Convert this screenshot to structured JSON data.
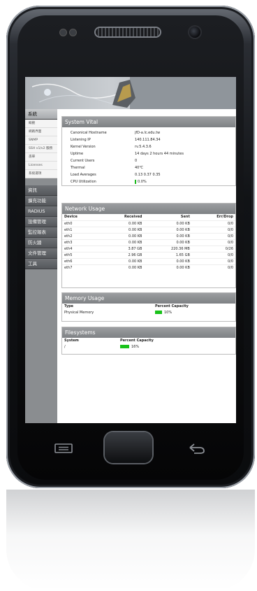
{
  "sidebar": {
    "groups": [
      {
        "label": "系統",
        "items": [
          "概觀",
          "網路界面",
          "SNMP",
          "SSH v1/v2 服務",
          "憑單",
          "Licenses",
          "系統選項"
        ]
      },
      {
        "label": "資訊"
      },
      {
        "label": "擴充功能"
      },
      {
        "label": "RADIUS"
      },
      {
        "label": "設備管理"
      },
      {
        "label": "監控報表"
      },
      {
        "label": "防火牆"
      },
      {
        "label": "文件管理"
      },
      {
        "label": "工具"
      }
    ]
  },
  "system_vital": {
    "title": "System Vital",
    "rows": [
      {
        "key": "Canonical Hostname",
        "value": "jfD-a.lc.edu.tw"
      },
      {
        "key": "Listening IP",
        "value": "140.111.84.34"
      },
      {
        "key": "Kernel Version",
        "value": "rv.5.4.3.6"
      },
      {
        "key": "Uptime",
        "value": "14 days 2 hours 44 minutes"
      },
      {
        "key": "Current Users",
        "value": "0"
      },
      {
        "key": "Thermal",
        "value": "40℃"
      },
      {
        "key": "Load Averages",
        "value": "0.13 0.37 0.35"
      },
      {
        "key": "CPU Utilization",
        "value": "0.0%"
      }
    ]
  },
  "network_usage": {
    "title": "Network Usage",
    "columns": [
      "Device",
      "Received",
      "Sent",
      "Err/Drop"
    ],
    "rows": [
      [
        "eth0",
        "0.00 KB",
        "0.00 KB",
        "0/0"
      ],
      [
        "eth1",
        "0.00 KB",
        "0.00 KB",
        "0/0"
      ],
      [
        "eth2",
        "0.00 KB",
        "0.00 KB",
        "0/0"
      ],
      [
        "eth3",
        "0.00 KB",
        "0.00 KB",
        "0/0"
      ],
      [
        "eth4",
        "3.87 GB",
        "220.36 MB",
        "0/26"
      ],
      [
        "eth5",
        "2.96 GB",
        "1.65 GB",
        "0/0"
      ],
      [
        "eth6",
        "0.00 KB",
        "0.00 KB",
        "0/0"
      ],
      [
        "eth7",
        "0.00 KB",
        "0.00 KB",
        "0/0"
      ]
    ]
  },
  "memory_usage": {
    "title": "Memory Usage",
    "columns": [
      "Type",
      "Percent Capacity"
    ],
    "rows": [
      {
        "type": "Physical Memory",
        "percent_label": "10%",
        "percent": 10
      }
    ]
  },
  "filesystems": {
    "title": "Filesystems",
    "columns": [
      "System",
      "Percent Capacity"
    ],
    "rows": [
      {
        "system": "/",
        "percent_label": "16%",
        "percent": 16
      }
    ]
  },
  "colors": {
    "accent_bar": "#19c21a",
    "panel_header": "#8a8d90",
    "sidebar": "#8a8d90"
  },
  "icons": [
    "menu-icon",
    "home-button",
    "back-arrow-icon"
  ]
}
